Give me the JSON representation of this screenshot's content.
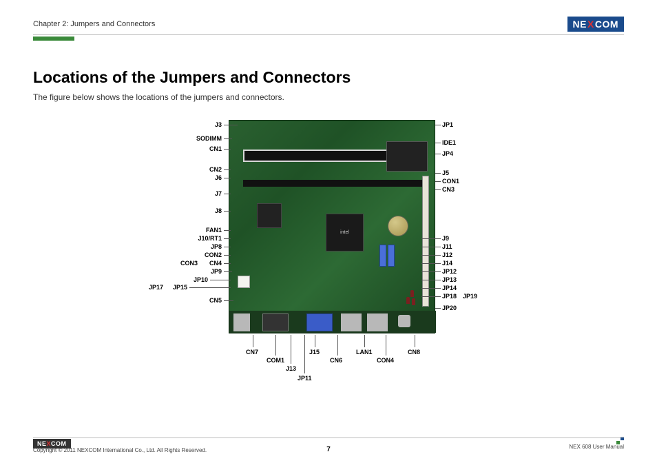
{
  "header": {
    "chapter": "Chapter 2: Jumpers and Connectors",
    "logo_text_left": "NE",
    "logo_text_x": "X",
    "logo_text_right": "COM"
  },
  "title": "Locations of the Jumpers and Connectors",
  "subtitle": "The figure below shows the locations of the jumpers and connectors.",
  "labels_left": [
    "J3",
    "SODIMM",
    "CN1",
    "CN2",
    "J6",
    "J7",
    "J8",
    "FAN1",
    "J10/RT1",
    "JP8",
    "CON2",
    "CON3",
    "CN4",
    "JP9",
    "JP10",
    "JP15",
    "JP17",
    "CN5"
  ],
  "labels_right": [
    "JP1",
    "IDE1",
    "JP4",
    "J5",
    "CON1",
    "CN3",
    "J9",
    "J11",
    "J12",
    "J14",
    "JP12",
    "JP13",
    "JP14",
    "JP18",
    "JP19",
    "JP20"
  ],
  "labels_bottom": [
    "CN7",
    "COM1",
    "J13",
    "JP11",
    "J15",
    "CN6",
    "LAN1",
    "CON4",
    "CN8"
  ],
  "chip_label": "intel",
  "footer": {
    "copyright": "Copyright © 2011 NEXCOM International Co., Ltd. All Rights Reserved.",
    "page": "7",
    "manual": "NEX 608 User Manual"
  }
}
